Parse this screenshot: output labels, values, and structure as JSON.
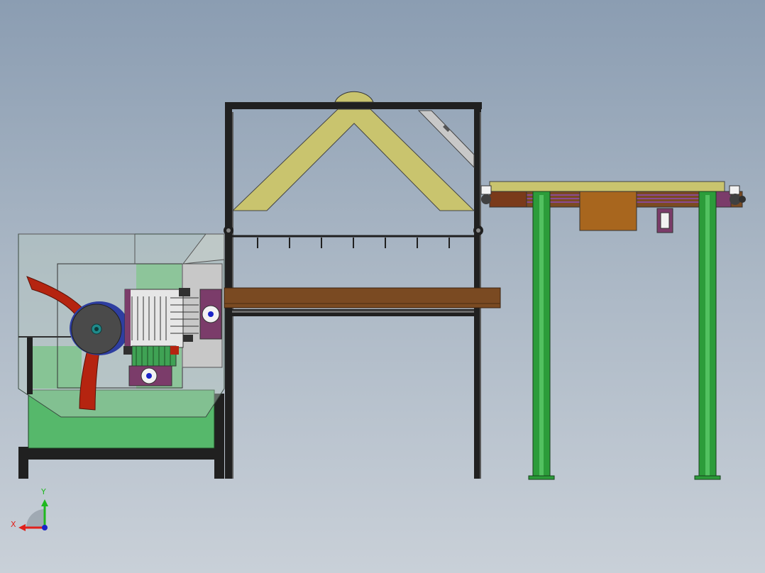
{
  "viewport": {
    "background_top": "#8b9db2",
    "background_bottom": "#c9d0d8"
  },
  "triad": {
    "x_label": "X",
    "y_label": "Y",
    "x_color": "#e0201b",
    "y_color": "#1fb81f",
    "z_color": "#1a24c8"
  },
  "model_colors": {
    "frame_black": "#202020",
    "hopper_green": "#55b86a",
    "fan_blade_red": "#b52410",
    "belt_brown": "#7a4a22",
    "yellow_panel": "#c9c46e",
    "leg_green": "#2c9c3a",
    "motor_box_orange": "#a8661e",
    "purple_bracket": "#7b3c6a"
  }
}
